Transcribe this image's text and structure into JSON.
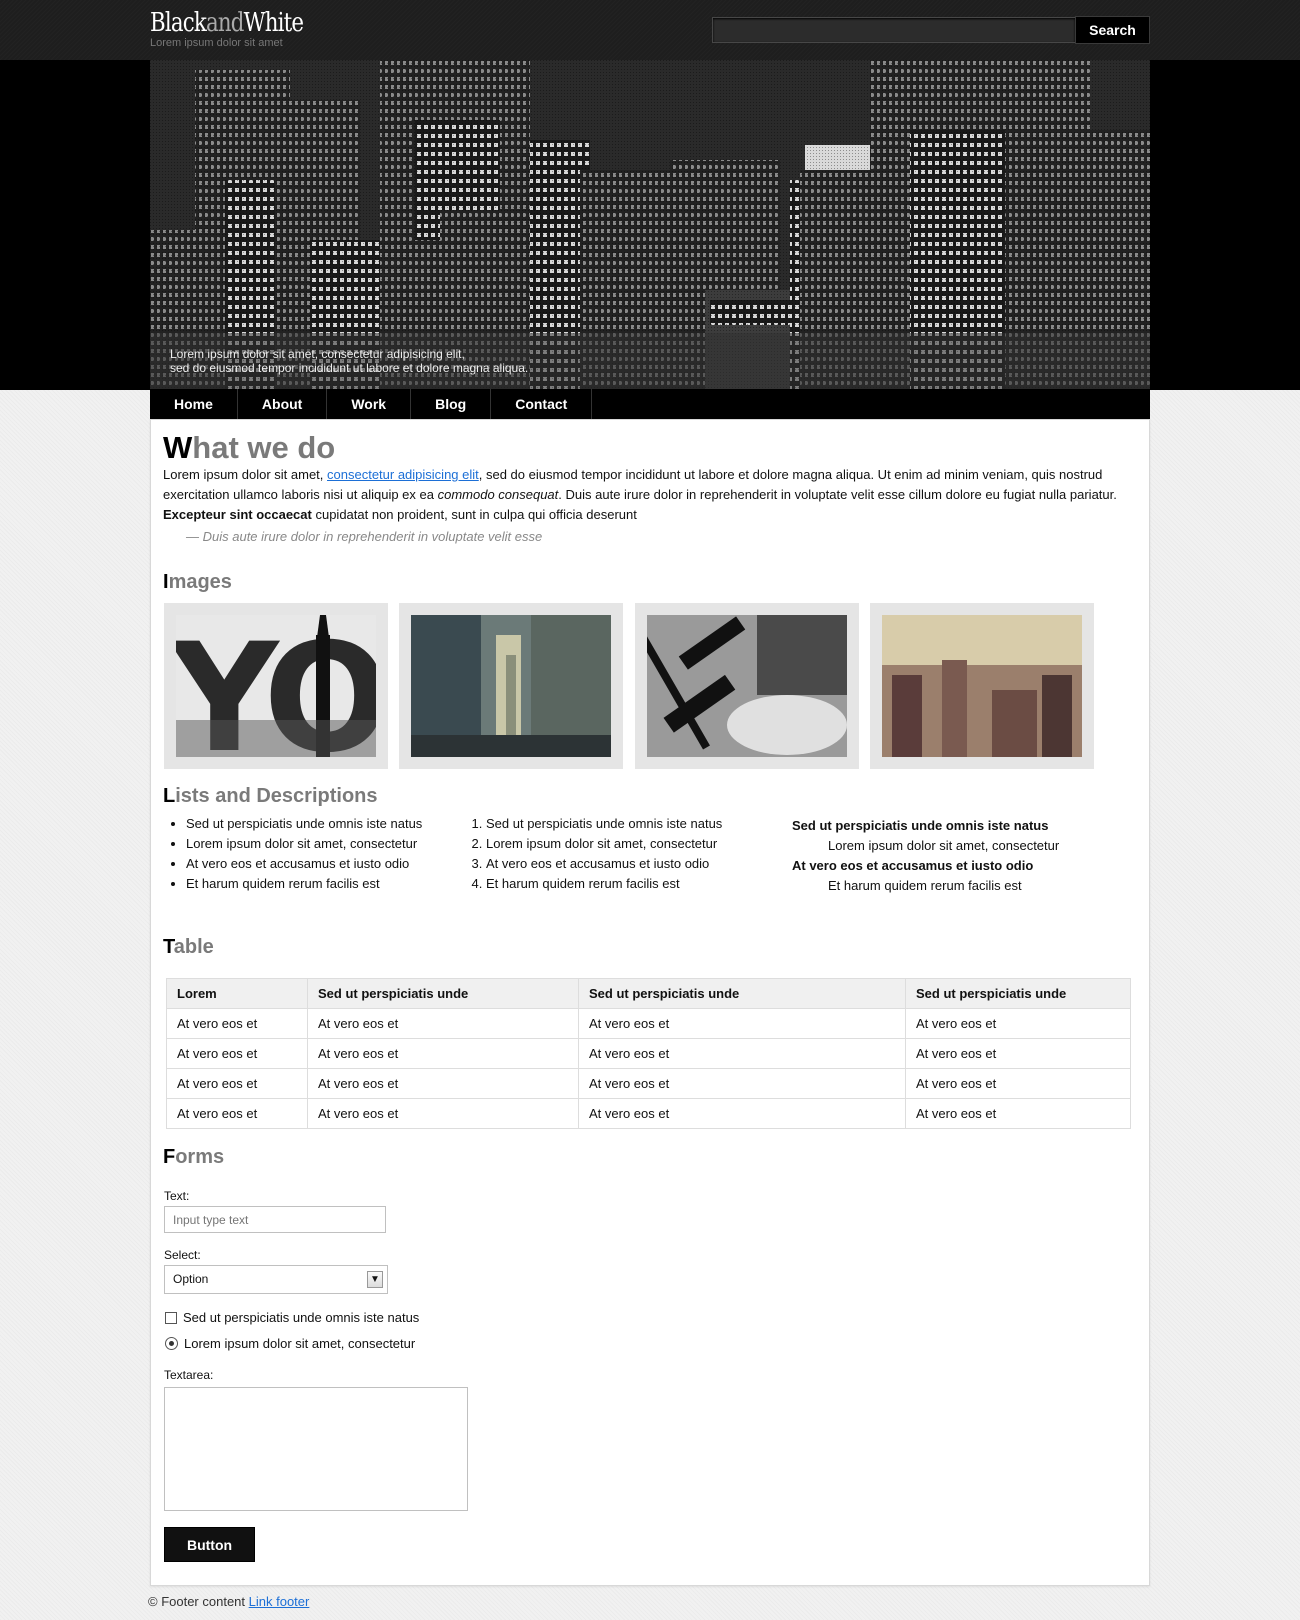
{
  "brand": {
    "name_part1": "Black",
    "name_part2": "and",
    "name_part3": "White",
    "tagline": "Lorem ipsum dolor sit amet"
  },
  "search": {
    "placeholder": "",
    "button_label": "Search"
  },
  "hero": {
    "caption_line1": "Lorem ipsum dolor sit amet, consectetur adipisicing elit,",
    "caption_line2": "sed do eiusmod tempor incididunt ut labore et dolore magna aliqua."
  },
  "nav": {
    "items": [
      "Home",
      "About",
      "Work",
      "Blog",
      "Contact"
    ]
  },
  "intro": {
    "heading_first": "W",
    "heading_rest": "hat we do",
    "p_text1": "Lorem ipsum dolor sit amet, ",
    "p_link": "consectetur adipisicing elit",
    "p_text2": ", sed do eiusmod tempor incididunt ut labore et dolore magna aliqua. Ut enim ad minim veniam, quis nostrud exercitation ullamco laboris nisi ut aliquip ex ea ",
    "p_em": "commodo consequat",
    "p_text3": ". Duis aute irure dolor in reprehenderit in voluptate velit esse cillum dolore eu fugiat nulla pariatur.",
    "p_strong": "Excepteur sint occaecat",
    "p_text4": " cupidatat non proident, sunt in culpa qui officia deserunt",
    "quote": "— Duis aute irure dolor in reprehenderit in voluptate velit esse"
  },
  "images_section": {
    "heading_first": "I",
    "heading_rest": "mages",
    "letters": "YOR"
  },
  "lists": {
    "heading_first": "L",
    "heading_rest": "ists and Descriptions",
    "bullets": [
      "Sed ut perspiciatis unde omnis iste natus",
      "Lorem ipsum dolor sit amet, consectetur",
      "At vero eos et accusamus et iusto odio",
      "Et harum quidem rerum facilis est"
    ],
    "numbered": [
      "Sed ut perspiciatis unde omnis iste natus",
      "Lorem ipsum dolor sit amet, consectetur",
      "At vero eos et accusamus et iusto odio",
      "Et harum quidem rerum facilis est"
    ],
    "desc": [
      {
        "term": "Sed ut perspiciatis unde omnis iste natus",
        "def": "Lorem ipsum dolor sit amet, consectetur"
      },
      {
        "term": "At vero eos et accusamus et iusto odio",
        "def": "Et harum quidem rerum facilis est"
      }
    ]
  },
  "table_section": {
    "heading_first": "T",
    "heading_rest": "able",
    "headers": [
      "Lorem",
      "Sed ut perspiciatis unde",
      "Sed ut perspiciatis unde",
      "Sed ut perspiciatis unde"
    ],
    "rows": [
      [
        "At vero eos et",
        "At vero eos et",
        "At vero eos et",
        "At vero eos et"
      ],
      [
        "At vero eos et",
        "At vero eos et",
        "At vero eos et",
        "At vero eos et"
      ],
      [
        "At vero eos et",
        "At vero eos et",
        "At vero eos et",
        "At vero eos et"
      ],
      [
        "At vero eos et",
        "At vero eos et",
        "At vero eos et",
        "At vero eos et"
      ]
    ]
  },
  "forms": {
    "heading_first": "F",
    "heading_rest": "orms",
    "text_label": "Text:",
    "text_placeholder": "Input type text",
    "select_label": "Select:",
    "select_value": "Option",
    "checkbox_label": "Sed ut perspiciatis unde omnis iste natus",
    "radio_label": "Lorem ipsum dolor sit amet, consectetur",
    "textarea_label": "Textarea:",
    "button_label": "Button"
  },
  "footer": {
    "text": "© Footer content ",
    "link": "Link footer"
  },
  "colors": {
    "link": "#1c6fd6",
    "heading_grey": "#7a7a7a",
    "nav_bg": "#000000"
  }
}
